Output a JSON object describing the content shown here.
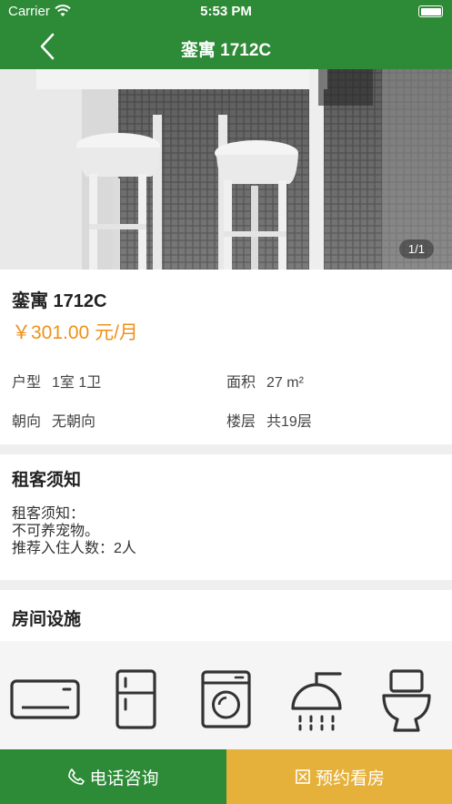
{
  "status_bar": {
    "carrier": "Carrier",
    "time": "5:53 PM"
  },
  "nav": {
    "title": "銮寓 1712C"
  },
  "gallery": {
    "counter": "1/1"
  },
  "listing": {
    "name": "銮寓 1712C",
    "price": "￥301.00 元/月",
    "specs": [
      {
        "key": "户型",
        "value": "1室 1卫"
      },
      {
        "key": "面积",
        "value": "27 m²"
      },
      {
        "key": "朝向",
        "value": "无朝向"
      },
      {
        "key": "楼层",
        "value": "共19层"
      }
    ]
  },
  "notice": {
    "title": "租客须知",
    "lines": [
      "租客须知：",
      "不可养宠物。",
      "推荐入住人数：2人"
    ]
  },
  "facilities": {
    "title": "房间设施",
    "icons": [
      "air-conditioner-icon",
      "refrigerator-icon",
      "washing-machine-icon",
      "shower-icon",
      "toilet-icon"
    ]
  },
  "actions": {
    "call_label": "电话咨询",
    "book_label": "预约看房"
  },
  "colors": {
    "primary_green": "#2d8a36",
    "price_orange": "#f0901a",
    "book_yellow": "#e6b13a"
  }
}
